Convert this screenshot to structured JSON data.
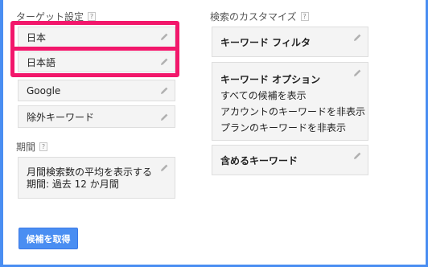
{
  "target": {
    "heading": "ターゲット設定",
    "help": "?",
    "items": [
      {
        "label": "日本"
      },
      {
        "label": "日本語"
      },
      {
        "label": "Google"
      },
      {
        "label": "除外キーワード"
      }
    ]
  },
  "period": {
    "heading": "期間",
    "help": "?",
    "line1": "月間検索数の平均を表示する",
    "line2": "期間: 過去 12 か月間"
  },
  "customize": {
    "heading": "検索のカスタマイズ",
    "help": "?",
    "keyword_filter": "キーワード フィルタ",
    "options_title": "キーワード オプション",
    "options": [
      "すべての候補を表示",
      "アカウントのキーワードを非表示",
      "プランのキーワードを非表示"
    ],
    "include_keywords": "含めるキーワード"
  },
  "get_ideas_button": "候補を取得",
  "colors": {
    "highlight": "#f2176b",
    "accent": "#4a8ef2",
    "card_bg": "#f4f4f4",
    "icon": "#b0b0b0"
  },
  "icons": [
    "pencil-icon",
    "help-icon"
  ]
}
